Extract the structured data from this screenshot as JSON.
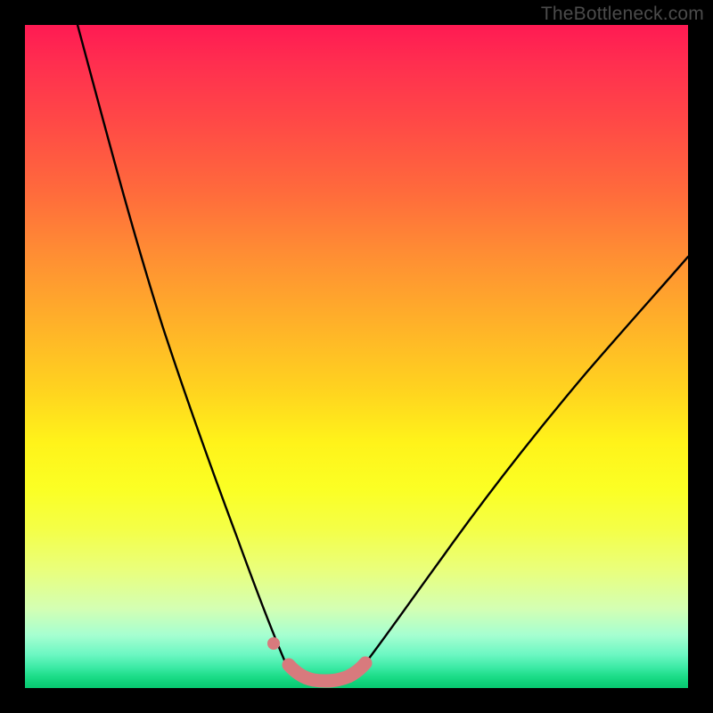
{
  "watermark": "TheBottleneck.com",
  "colors": {
    "background": "#000000",
    "gradient_top": "#ff1a53",
    "gradient_mid": "#fff31a",
    "gradient_bottom": "#08c870",
    "curve": "#000000",
    "highlight": "#d87a7d"
  },
  "chart_data": {
    "type": "line",
    "title": "",
    "xlabel": "",
    "ylabel": "",
    "xlim": [
      0,
      100
    ],
    "ylim": [
      0,
      100
    ],
    "grid": false,
    "legend": false,
    "annotations": [
      "TheBottleneck.com"
    ],
    "series": [
      {
        "name": "left-branch",
        "x": [
          8,
          12,
          16,
          20,
          24,
          28,
          32,
          34.5,
          37,
          39
        ],
        "values": [
          100,
          84,
          69,
          55,
          42,
          31,
          20,
          13,
          7,
          3
        ]
      },
      {
        "name": "valley",
        "x": [
          39,
          41,
          43,
          45,
          47,
          49,
          50.5
        ],
        "values": [
          3,
          1.6,
          1.1,
          1.0,
          1.1,
          1.6,
          2.6
        ]
      },
      {
        "name": "right-branch",
        "x": [
          50.5,
          54,
          58,
          64,
          72,
          80,
          88,
          96,
          100
        ],
        "values": [
          2.6,
          6,
          11,
          19,
          30,
          41,
          52,
          62,
          67
        ]
      },
      {
        "name": "highlighted-valley-segment",
        "x": [
          39,
          41,
          43,
          45,
          47,
          49,
          50.5
        ],
        "values": [
          3,
          1.6,
          1.1,
          1.0,
          1.1,
          1.6,
          2.6
        ]
      }
    ],
    "markers": [
      {
        "name": "highlight-dot",
        "x": 37.3,
        "y": 6.2
      }
    ]
  }
}
